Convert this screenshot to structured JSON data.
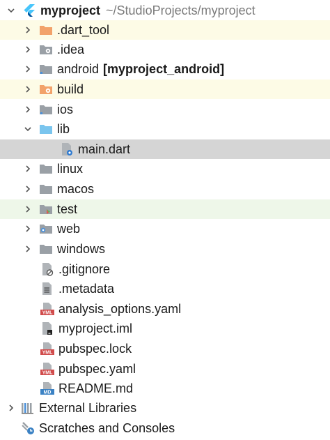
{
  "root": {
    "name": "myproject",
    "path": "~/StudioProjects/myproject"
  },
  "items": [
    {
      "label": ".dart_tool"
    },
    {
      "label": ".idea"
    },
    {
      "label": "android",
      "suffix": "[myproject_android]"
    },
    {
      "label": "build"
    },
    {
      "label": "ios"
    },
    {
      "label": "lib"
    },
    {
      "label": "main.dart"
    },
    {
      "label": "linux"
    },
    {
      "label": "macos"
    },
    {
      "label": "test"
    },
    {
      "label": "web"
    },
    {
      "label": "windows"
    },
    {
      "label": ".gitignore"
    },
    {
      "label": ".metadata"
    },
    {
      "label": "analysis_options.yaml"
    },
    {
      "label": "myproject.iml"
    },
    {
      "label": "pubspec.lock"
    },
    {
      "label": "pubspec.yaml"
    },
    {
      "label": "README.md"
    }
  ],
  "external_libraries": "External Libraries",
  "scratches": "Scratches and Consoles",
  "colors": {
    "folder_gray": "#9aa0a6",
    "folder_orange": "#f2a26a",
    "folder_blue": "#7ac5ee",
    "selection": "#d5d5d5"
  }
}
